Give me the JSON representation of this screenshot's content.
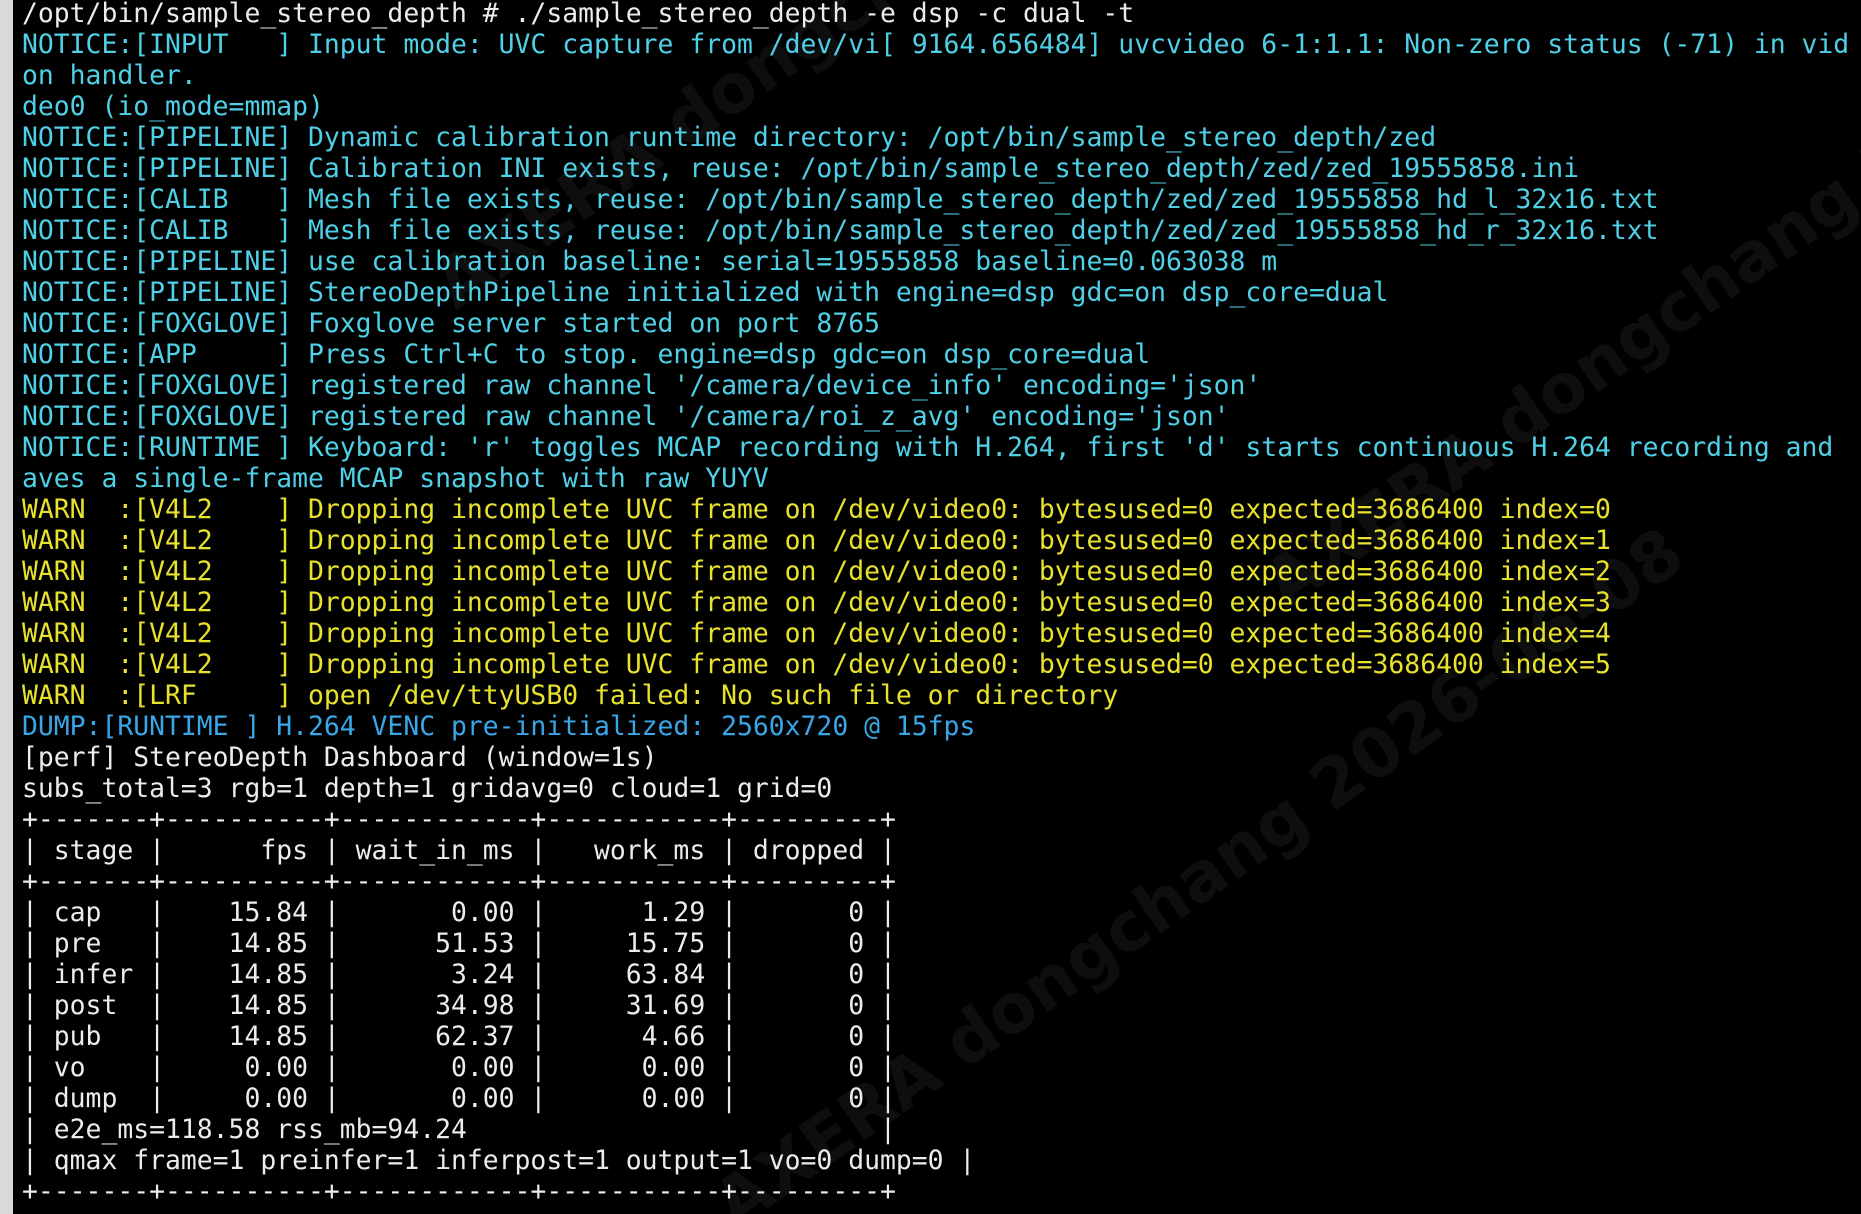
{
  "terminal": {
    "watermark_text": "AXERA dongchang 2026-06-08",
    "colors": {
      "background": "#000000",
      "default": "#ececec",
      "notice": "#4fd0e6",
      "warn": "#e8e22d",
      "dump": "#3aa6e6"
    },
    "lines": [
      {
        "color": "white",
        "text": "/opt/bin/sample_stereo_depth # ./sample_stereo_depth -e dsp -c dual -t"
      },
      {
        "color": "cyan",
        "text": "NOTICE:[INPUT   ] Input mode: UVC capture from /dev/vi[ 9164.656484] uvcvideo 6-1:1.1: Non-zero status (-71) in vid"
      },
      {
        "color": "cyan",
        "text": "on handler."
      },
      {
        "color": "cyan",
        "text": "deo0 (io_mode=mmap)"
      },
      {
        "color": "cyan",
        "text": "NOTICE:[PIPELINE] Dynamic calibration runtime directory: /opt/bin/sample_stereo_depth/zed"
      },
      {
        "color": "cyan",
        "text": "NOTICE:[PIPELINE] Calibration INI exists, reuse: /opt/bin/sample_stereo_depth/zed/zed_19555858.ini"
      },
      {
        "color": "cyan",
        "text": "NOTICE:[CALIB   ] Mesh file exists, reuse: /opt/bin/sample_stereo_depth/zed/zed_19555858_hd_l_32x16.txt"
      },
      {
        "color": "cyan",
        "text": "NOTICE:[CALIB   ] Mesh file exists, reuse: /opt/bin/sample_stereo_depth/zed/zed_19555858_hd_r_32x16.txt"
      },
      {
        "color": "cyan",
        "text": "NOTICE:[PIPELINE] use calibration baseline: serial=19555858 baseline=0.063038 m"
      },
      {
        "color": "cyan",
        "text": "NOTICE:[PIPELINE] StereoDepthPipeline initialized with engine=dsp gdc=on dsp_core=dual"
      },
      {
        "color": "cyan",
        "text": "NOTICE:[FOXGLOVE] Foxglove server started on port 8765"
      },
      {
        "color": "cyan",
        "text": "NOTICE:[APP     ] Press Ctrl+C to stop. engine=dsp gdc=on dsp_core=dual"
      },
      {
        "color": "cyan",
        "text": "NOTICE:[FOXGLOVE] registered raw channel '/camera/device_info' encoding='json'"
      },
      {
        "color": "cyan",
        "text": "NOTICE:[FOXGLOVE] registered raw channel '/camera/roi_z_avg' encoding='json'"
      },
      {
        "color": "cyan",
        "text": "NOTICE:[RUNTIME ] Keyboard: 'r' toggles MCAP recording with H.264, first 'd' starts continuous H.264 recording and"
      },
      {
        "color": "cyan",
        "text": "aves a single-frame MCAP snapshot with raw YUYV"
      },
      {
        "color": "yellow",
        "text": "WARN  :[V4L2    ] Dropping incomplete UVC frame on /dev/video0: bytesused=0 expected=3686400 index=0"
      },
      {
        "color": "yellow",
        "text": "WARN  :[V4L2    ] Dropping incomplete UVC frame on /dev/video0: bytesused=0 expected=3686400 index=1"
      },
      {
        "color": "yellow",
        "text": "WARN  :[V4L2    ] Dropping incomplete UVC frame on /dev/video0: bytesused=0 expected=3686400 index=2"
      },
      {
        "color": "yellow",
        "text": "WARN  :[V4L2    ] Dropping incomplete UVC frame on /dev/video0: bytesused=0 expected=3686400 index=3"
      },
      {
        "color": "yellow",
        "text": "WARN  :[V4L2    ] Dropping incomplete UVC frame on /dev/video0: bytesused=0 expected=3686400 index=4"
      },
      {
        "color": "yellow",
        "text": "WARN  :[V4L2    ] Dropping incomplete UVC frame on /dev/video0: bytesused=0 expected=3686400 index=5"
      },
      {
        "color": "yellow",
        "text": "WARN  :[LRF     ] open /dev/ttyUSB0 failed: No such file or directory"
      },
      {
        "color": "blue",
        "text": "DUMP:[RUNTIME ] H.264 VENC pre-initialized: 2560x720 @ 15fps"
      },
      {
        "color": "white",
        "text": "[perf] StereoDepth Dashboard (window=1s)"
      },
      {
        "color": "white",
        "text": "subs_total=3 rgb=1 depth=1 gridavg=0 cloud=1 grid=0"
      },
      {
        "color": "white",
        "text": "+-------+----------+------------+-----------+---------+"
      },
      {
        "color": "white",
        "text": "| stage |      fps | wait_in_ms |   work_ms | dropped |"
      },
      {
        "color": "white",
        "text": "+-------+----------+------------+-----------+---------+"
      },
      {
        "color": "white",
        "text": "| cap   |    15.84 |       0.00 |      1.29 |       0 |"
      },
      {
        "color": "white",
        "text": "| pre   |    14.85 |      51.53 |     15.75 |       0 |"
      },
      {
        "color": "white",
        "text": "| infer |    14.85 |       3.24 |     63.84 |       0 |"
      },
      {
        "color": "white",
        "text": "| post  |    14.85 |      34.98 |     31.69 |       0 |"
      },
      {
        "color": "white",
        "text": "| pub   |    14.85 |      62.37 |      4.66 |       0 |"
      },
      {
        "color": "white",
        "text": "| vo    |     0.00 |       0.00 |      0.00 |       0 |"
      },
      {
        "color": "white",
        "text": "| dump  |     0.00 |       0.00 |      0.00 |       0 |"
      },
      {
        "color": "white",
        "text": "| e2e_ms=118.58 rss_mb=94.24                          |"
      },
      {
        "color": "white",
        "text": "| qmax frame=1 preinfer=1 inferpost=1 output=1 vo=0 dump=0 |"
      },
      {
        "color": "white",
        "text": "+-------+----------+------------+-----------+---------+"
      }
    ]
  }
}
